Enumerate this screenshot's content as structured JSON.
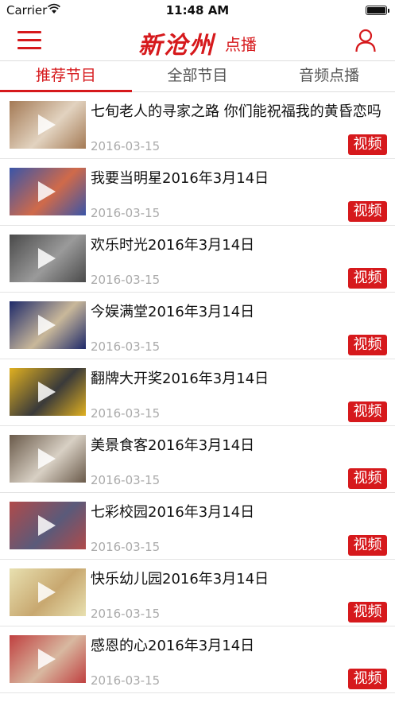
{
  "status_bar": {
    "carrier": "Carrier",
    "time": "11:48 AM"
  },
  "header": {
    "logo_text": "新沧州",
    "subtitle": "点播"
  },
  "tabs": [
    {
      "label": "推荐节目"
    },
    {
      "label": "全部节目"
    },
    {
      "label": "音频点播"
    }
  ],
  "items": [
    {
      "title": "七旬老人的寻家之路 你们能祝福我的黄昏恋吗",
      "date": "2016-03-15",
      "badge": "视频",
      "thumb_colors": [
        "#a47a55",
        "#e2d3c0"
      ]
    },
    {
      "title": "我要当明星2016年3月14日",
      "date": "2016-03-15",
      "badge": "视频",
      "thumb_colors": [
        "#3a55a8",
        "#d06a4a"
      ]
    },
    {
      "title": "欢乐时光2016年3月14日",
      "date": "2016-03-15",
      "badge": "视频",
      "thumb_colors": [
        "#4a4a4a",
        "#9a9a9a"
      ]
    },
    {
      "title": "今娱满堂2016年3月14日",
      "date": "2016-03-15",
      "badge": "视频",
      "thumb_colors": [
        "#1e2a6a",
        "#c9b89a"
      ]
    },
    {
      "title": "翻牌大开奖2016年3月14日",
      "date": "2016-03-15",
      "badge": "视频",
      "thumb_colors": [
        "#e0b020",
        "#3a3a3a"
      ]
    },
    {
      "title": "美景食客2016年3月14日",
      "date": "2016-03-15",
      "badge": "视频",
      "thumb_colors": [
        "#6a5a4a",
        "#d8d0c4"
      ]
    },
    {
      "title": "七彩校园2016年3月14日",
      "date": "2016-03-15",
      "badge": "视频",
      "thumb_colors": [
        "#b04a4a",
        "#5a5a7a"
      ]
    },
    {
      "title": "快乐幼儿园2016年3月14日",
      "date": "2016-03-15",
      "badge": "视频",
      "thumb_colors": [
        "#e8e0b0",
        "#c8a870"
      ]
    },
    {
      "title": "感恩的心2016年3月14日",
      "date": "2016-03-15",
      "badge": "视频",
      "thumb_colors": [
        "#c04040",
        "#d8b8a0"
      ]
    }
  ],
  "colors": {
    "accent": "#d6191c",
    "date_gray": "#aaaaaa",
    "divider": "#e4e4e4"
  },
  "icons": {
    "menu": "hamburger-icon",
    "user": "user-icon",
    "play": "play-icon",
    "wifi": "wifi-icon",
    "battery": "battery-icon"
  }
}
